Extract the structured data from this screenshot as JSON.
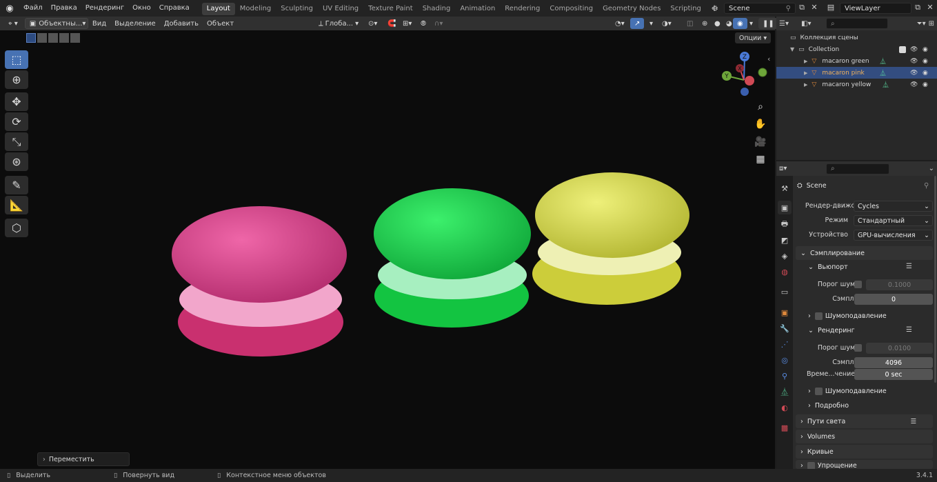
{
  "topbar": {
    "menus": [
      "Файл",
      "Правка",
      "Рендеринг",
      "Окно",
      "Справка"
    ],
    "workspaces": [
      "Layout",
      "Modeling",
      "Sculpting",
      "UV Editing",
      "Texture Paint",
      "Shading",
      "Animation",
      "Rendering",
      "Compositing",
      "Geometry Nodes",
      "Scripting"
    ],
    "active_workspace": "Layout",
    "add_tab": "+",
    "scene_name": "Scene",
    "view_layer": "ViewLayer"
  },
  "viewport_header": {
    "mode": "Объектны...",
    "menus": [
      "Вид",
      "Выделение",
      "Добавить",
      "Объект"
    ],
    "orientation": "Глоба...",
    "options": "Опции"
  },
  "gizmo": {
    "z": "Z",
    "y": "Y",
    "x": "X"
  },
  "last_operator": "Переместить",
  "macarons": [
    {
      "name": "pink",
      "top": "#e0468f",
      "filling": "#f2a6cb",
      "bottom": "#e83a8a"
    },
    {
      "name": "green",
      "top": "#1ede4f",
      "filling": "#a7efc0",
      "bottom": "#17d84a"
    },
    {
      "name": "yellow",
      "top": "#e1e659",
      "filling": "#eef0b4",
      "bottom": "#e2e34a"
    }
  ],
  "outliner": {
    "scene_collection": "Коллекция сцены",
    "collection": "Collection",
    "objects": [
      "macaron green",
      "macaron pink",
      "macaron yellow"
    ],
    "selected_index": 1
  },
  "properties": {
    "scene_name": "Scene",
    "render_engine": {
      "label": "Рендер-движок",
      "value": "Cycles"
    },
    "mode": {
      "label": "Режим",
      "value": "Стандартный"
    },
    "device": {
      "label": "Устройство",
      "value": "GPU-вычисления"
    },
    "sampling": "Сэмплирование",
    "viewport": {
      "title": "Вьюпорт",
      "noise_threshold_label": "Порог шума",
      "noise_threshold": "0.1000",
      "samples_label": "Сэмплы",
      "samples": "0",
      "denoise": "Шумоподавление"
    },
    "render": {
      "title": "Рендеринг",
      "noise_threshold_label": "Порог шума",
      "noise_threshold": "0.0100",
      "samples_label": "Сэмплы",
      "samples": "4096",
      "time_limit_label": "Време...чениеё",
      "time_limit": "0 sec",
      "denoise": "Шумоподавление"
    },
    "advanced": "Подробно",
    "light_paths": "Пути света",
    "volumes": "Volumes",
    "curves": "Кривые",
    "simplify": "Упрощение"
  },
  "statusbar": {
    "select": "Выделить",
    "rotate_view": "Повернуть вид",
    "context_menu": "Контекстное меню объектов",
    "version": "3.4.1"
  },
  "colors": {
    "accent": "#4772b3",
    "selection": "#334d80",
    "object_orange": "#e08a3c",
    "mesh_green": "#5bd6a0"
  }
}
